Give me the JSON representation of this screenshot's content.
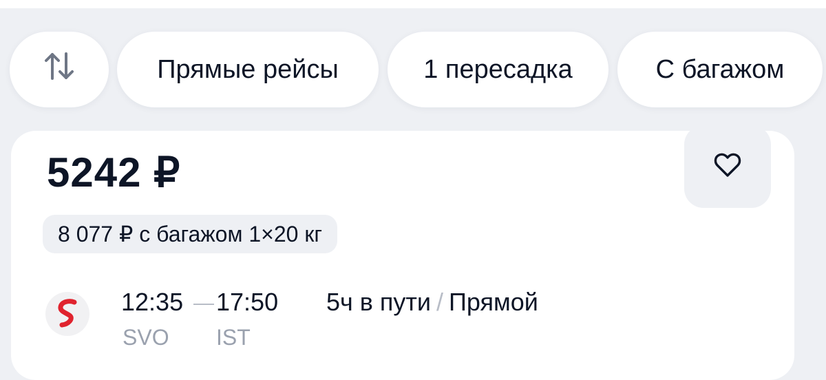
{
  "filters": {
    "sort_icon": "sort-arrows-icon",
    "direct": "Прямые рейсы",
    "one_transfer": "1 пересадка",
    "with_baggage": "С багажом"
  },
  "ticket": {
    "price": "5242 ₽",
    "favorite_icon": "heart-icon",
    "baggage_offer": "8 077 ₽ с багажом 1×20 кг",
    "airline_icon": "airline-s-logo",
    "departure_time": "12:35",
    "arrival_time": "17:50",
    "departure_code": "SVO",
    "arrival_code": "IST",
    "duration": "5ч в пути",
    "stops": "Прямой",
    "separator": "/"
  },
  "colors": {
    "background": "#eef0f4",
    "text": "#0d1526",
    "muted": "#9aa1ae",
    "airline_red": "#e0232e"
  }
}
